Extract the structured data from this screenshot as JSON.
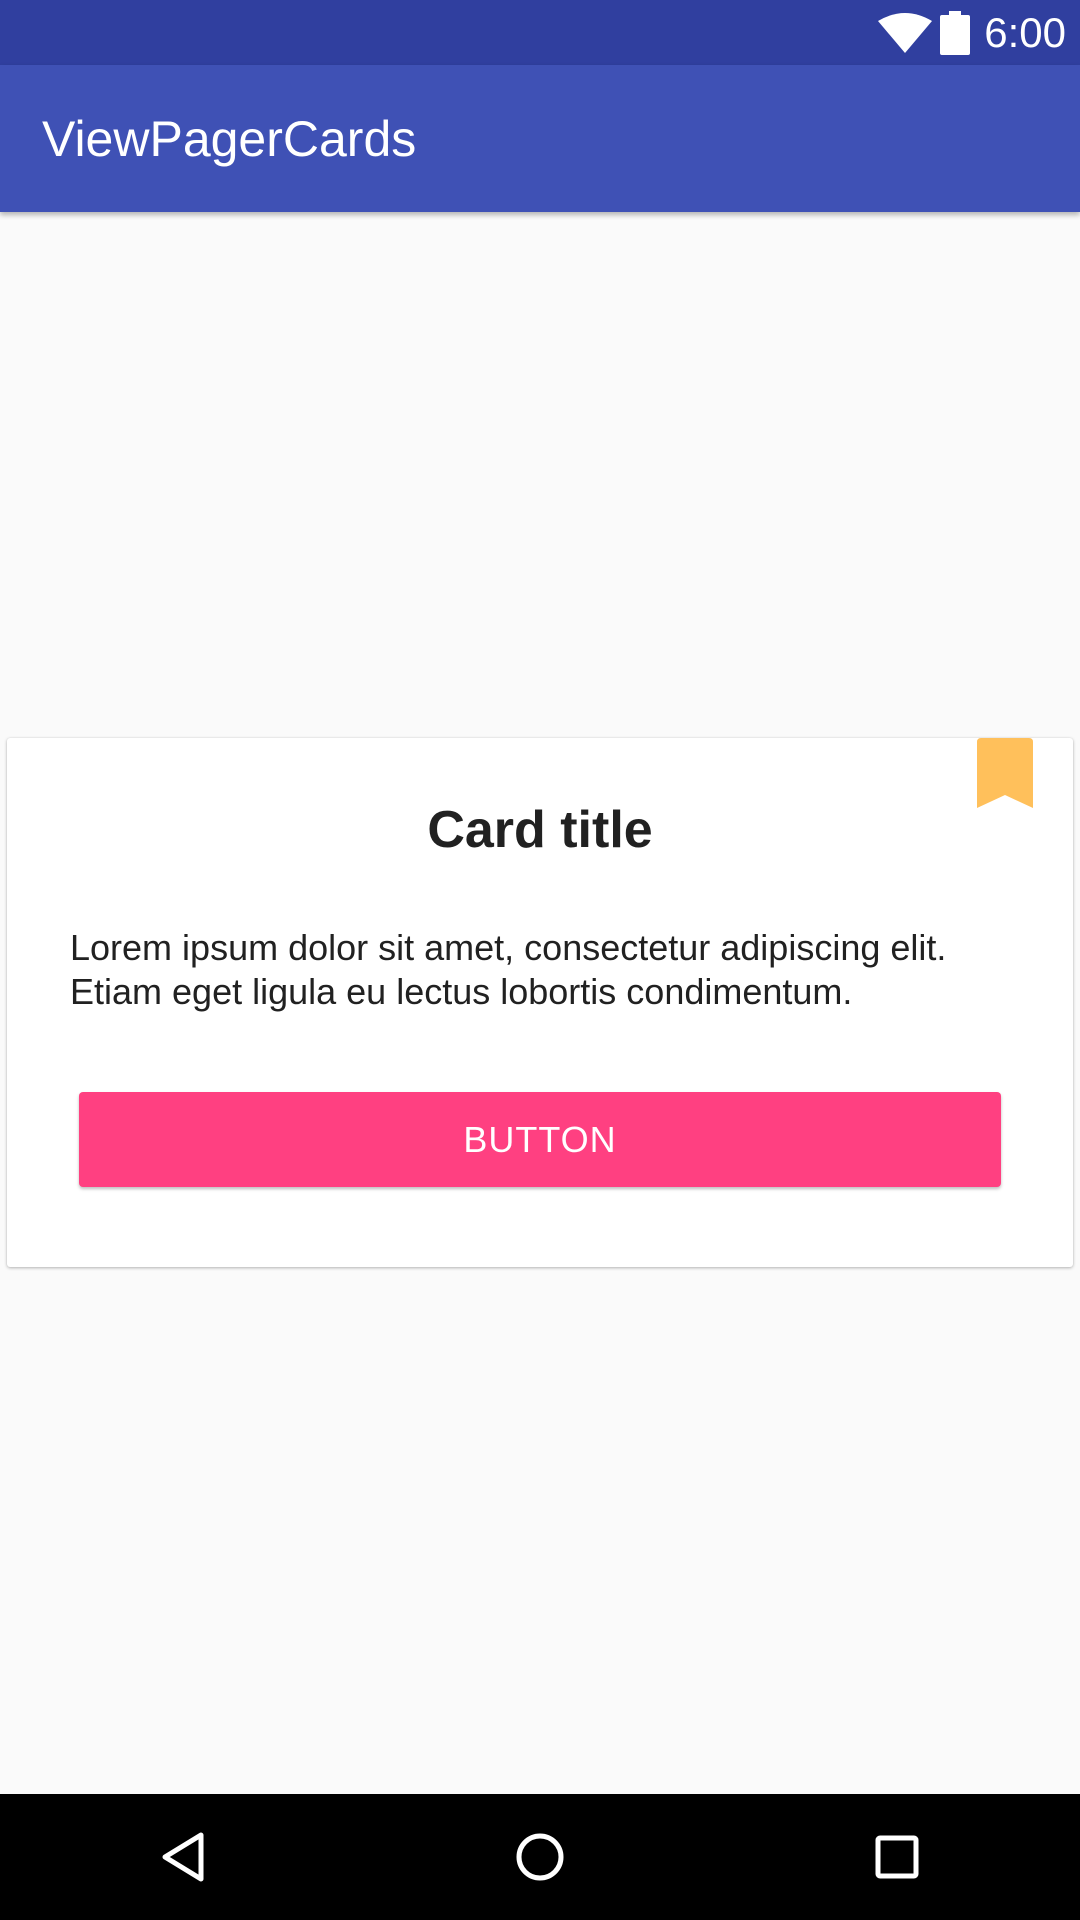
{
  "status_bar": {
    "time": "6:00",
    "icons": [
      "wifi-icon",
      "battery-icon"
    ]
  },
  "app_bar": {
    "title": "ViewPagerCards",
    "color": "#3f51b5",
    "status_color": "#303f9f"
  },
  "card": {
    "title": "Card title",
    "body": "Lorem ipsum dolor sit amet, consectetur adipiscing elit. Etiam eget ligula eu lectus lobortis condimentum.",
    "button_label": "BUTTON",
    "button_color": "#ff4081",
    "bookmark_color": "#ffc05b",
    "bookmark_icon": "bookmark-icon"
  },
  "nav_bar": {
    "buttons": [
      "back-icon",
      "home-icon",
      "recents-icon"
    ]
  }
}
